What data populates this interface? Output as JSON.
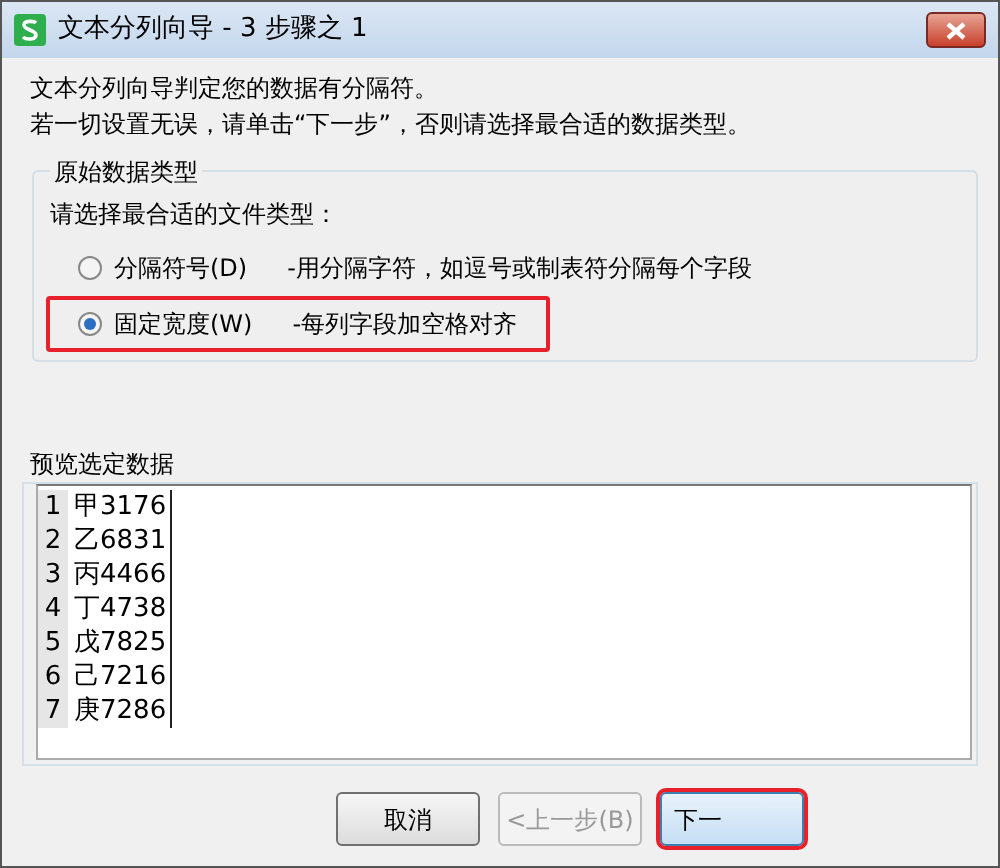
{
  "window": {
    "title": "文本分列向导 - 3 步骤之 1"
  },
  "intro": [
    "文本分列向导判定您的数据有分隔符。",
    "若一切设置无误，请单击“下一步”，否则请选择最合适的数据类型。"
  ],
  "data_type_group": {
    "title": "原始数据类型",
    "prompt": "请选择最合适的文件类型：",
    "options": [
      {
        "label": "分隔符号(D)",
        "description": "-用分隔字符，如逗号或制表符分隔每个字段",
        "selected": false,
        "highlighted": false
      },
      {
        "label": "固定宽度(W)",
        "description": "-每列字段加空格对齐",
        "selected": true,
        "highlighted": true
      }
    ]
  },
  "preview": {
    "title": "预览选定数据",
    "rows": [
      {
        "number": "1",
        "text": "甲3176"
      },
      {
        "number": "2",
        "text": "乙6831"
      },
      {
        "number": "3",
        "text": "丙4466"
      },
      {
        "number": "4",
        "text": "丁4738"
      },
      {
        "number": "5",
        "text": "戊7825"
      },
      {
        "number": "6",
        "text": "己7216"
      },
      {
        "number": "7",
        "text": "庚7286"
      }
    ]
  },
  "buttons": [
    {
      "label": "取消",
      "disabled": false,
      "highlighted": false
    },
    {
      "label": "<上一步(B)",
      "disabled": true,
      "highlighted": false
    },
    {
      "label": "下一",
      "disabled": false,
      "highlighted": true
    }
  ]
}
